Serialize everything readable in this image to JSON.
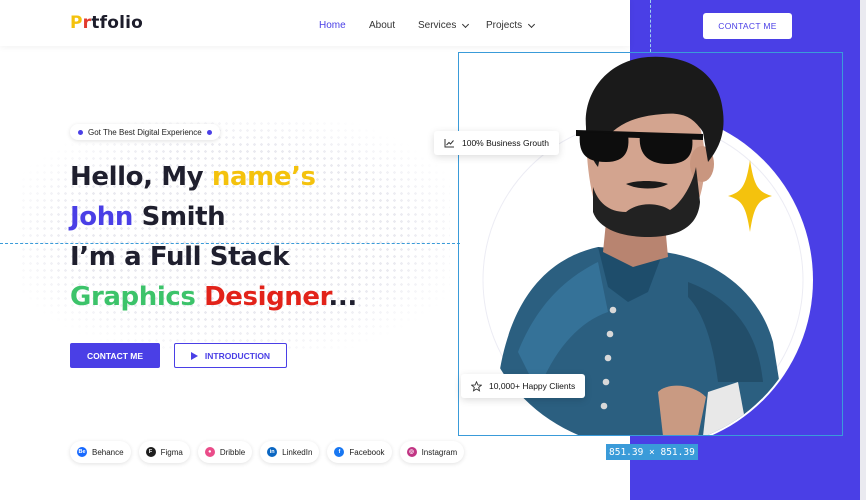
{
  "brand": {
    "logo_p": "P",
    "logo_r": "r",
    "logo_rest": "tfolio"
  },
  "nav": {
    "items": [
      {
        "label": "Home"
      },
      {
        "label": "About"
      },
      {
        "label": "Services"
      },
      {
        "label": "Projects"
      }
    ],
    "contact_label": "CONTACT ME"
  },
  "hero": {
    "badge": "Got The Best Digital Experience",
    "line1_a": "Hello, My ",
    "line1_b": "name’s",
    "line2_a": "John",
    "line2_b": " Smith",
    "line3": "I’m a Full Stack",
    "line4_a": "Graphics",
    "line4_b": " Designer",
    "line4_c": "...",
    "contact_label": "CONTACT ME",
    "intro_label": "INTRODUCTION"
  },
  "socials": [
    {
      "label": "Behance",
      "icon": "behance-icon",
      "color": "#1769ff",
      "glyph": "Be"
    },
    {
      "label": "Figma",
      "icon": "figma-icon",
      "color": "#1e1e1e",
      "glyph": "F"
    },
    {
      "label": "Dribble",
      "icon": "dribbble-icon",
      "color": "#ea4c89",
      "glyph": "●"
    },
    {
      "label": "LinkedIn",
      "icon": "linkedin-icon",
      "color": "#0a66c2",
      "glyph": "in"
    },
    {
      "label": "Facebook",
      "icon": "facebook-icon",
      "color": "#1877f2",
      "glyph": "f"
    },
    {
      "label": "Instagram",
      "icon": "instagram-icon",
      "color": "#c13584",
      "glyph": "◎"
    }
  ],
  "cards": {
    "growth": "100% Business Grouth",
    "clients": "10,000+ Happy Clients"
  },
  "selection_size": "851.39 × 851.39",
  "colors": {
    "accent": "#4a3fe6",
    "yellow": "#f4c20d",
    "green": "#3cc36a",
    "red": "#e2231a"
  }
}
